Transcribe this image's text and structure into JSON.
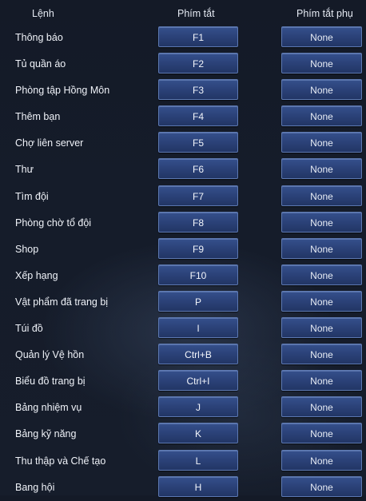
{
  "header": {
    "command": "Lệnh",
    "primary": "Phím tắt",
    "secondary": "Phím tắt phụ"
  },
  "rows": [
    {
      "label": "Thông báo",
      "primary": "F1",
      "secondary": "None"
    },
    {
      "label": "Tủ quần áo",
      "primary": "F2",
      "secondary": "None"
    },
    {
      "label": "Phòng tập Hồng Môn",
      "primary": "F3",
      "secondary": "None"
    },
    {
      "label": "Thêm bạn",
      "primary": "F4",
      "secondary": "None"
    },
    {
      "label": "Chợ liên server",
      "primary": "F5",
      "secondary": "None"
    },
    {
      "label": "Thư",
      "primary": "F6",
      "secondary": "None"
    },
    {
      "label": "Tìm đội",
      "primary": "F7",
      "secondary": "None"
    },
    {
      "label": "Phòng chờ tổ đội",
      "primary": "F8",
      "secondary": "None"
    },
    {
      "label": "Shop",
      "primary": "F9",
      "secondary": "None"
    },
    {
      "label": "Xếp hạng",
      "primary": "F10",
      "secondary": "None"
    },
    {
      "label": "Vật phẩm đã trang bị",
      "primary": "P",
      "secondary": "None"
    },
    {
      "label": "Túi đồ",
      "primary": "I",
      "secondary": "None"
    },
    {
      "label": "Quản lý Vệ hồn",
      "primary": "Ctrl+B",
      "secondary": "None"
    },
    {
      "label": "Biểu đồ trang bị",
      "primary": "Ctrl+I",
      "secondary": "None"
    },
    {
      "label": "Bảng nhiệm vụ",
      "primary": "J",
      "secondary": "None"
    },
    {
      "label": "Bảng kỹ năng",
      "primary": "K",
      "secondary": "None"
    },
    {
      "label": "Thu thập và Chế tạo",
      "primary": "L",
      "secondary": "None"
    },
    {
      "label": "Bang hội",
      "primary": "H",
      "secondary": "None"
    }
  ]
}
